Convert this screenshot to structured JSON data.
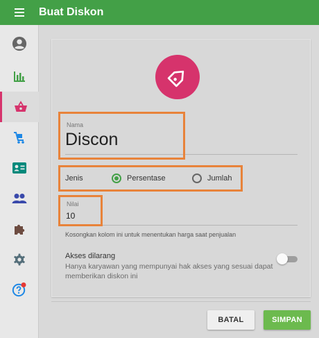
{
  "appbar": {
    "title": "Buat Diskon",
    "menu_icon": "menu-icon"
  },
  "sidebar": {
    "items": [
      {
        "icon": "account-circle-icon",
        "color": "#666666",
        "active": false
      },
      {
        "icon": "bar-chart-icon",
        "color": "#43a047",
        "active": false
      },
      {
        "icon": "basket-icon",
        "color": "#d6336c",
        "active": true
      },
      {
        "icon": "cart-icon",
        "color": "#1e88e5",
        "active": false
      },
      {
        "icon": "id-card-icon",
        "color": "#00897b",
        "active": false
      },
      {
        "icon": "people-icon",
        "color": "#3949ab",
        "active": false
      },
      {
        "icon": "puzzle-icon",
        "color": "#6d4c41",
        "active": false
      },
      {
        "icon": "gear-icon",
        "color": "#546e7a",
        "active": false
      },
      {
        "icon": "help-icon",
        "color": "#1e88e5",
        "active": false,
        "badge_color": "#e53935"
      }
    ]
  },
  "form": {
    "header_icon": "tag-icon",
    "accent_color": "#d6336c",
    "name": {
      "label": "Nama",
      "value": "Discon"
    },
    "jenis": {
      "label": "Jenis",
      "options": [
        "Persentase",
        "Jumlah"
      ],
      "selected": "Persentase"
    },
    "nilai": {
      "label": "Nilai",
      "value": "10",
      "helper": "Kosongkan kolom ini untuk menentukan harga saat penjualan"
    },
    "akses": {
      "title": "Akses dilarang",
      "description": "Hanya karyawan yang mempunyai hak akses yang sesuai dapat memberikan diskon ini",
      "enabled": false
    }
  },
  "actions": {
    "cancel_label": "BATAL",
    "save_label": "SIMPAN"
  },
  "colors": {
    "primary": "#43a047",
    "highlight": "#e8833a",
    "save_button": "#6cba4e"
  }
}
